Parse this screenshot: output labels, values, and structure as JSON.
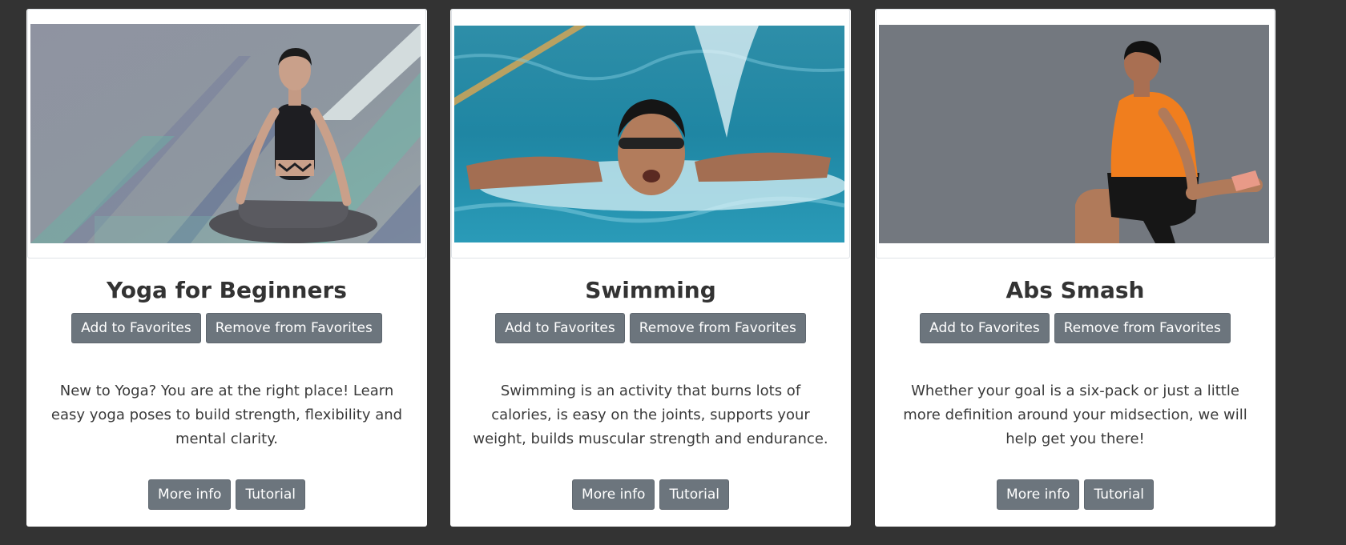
{
  "cards": [
    {
      "title": "Yoga for Beginners",
      "image_subject": "woman meditating in lotus pose",
      "add_label": "Add to Favorites",
      "remove_label": "Remove from Favorites",
      "description": "New to Yoga? You are at the right place! Learn easy yoga poses to build strength, flexibility and mental clarity.",
      "more_info_label": "More info",
      "tutorial_label": "Tutorial"
    },
    {
      "title": "Swimming",
      "image_subject": "swimmer doing butterfly stroke",
      "add_label": "Add to Favorites",
      "remove_label": "Remove from Favorites",
      "description": "Swimming is an activity that burns lots of calories, is easy on the joints, supports your weight, builds muscular strength and endurance.",
      "more_info_label": "More info",
      "tutorial_label": "Tutorial"
    },
    {
      "title": "Abs Smash",
      "image_subject": "man doing a lunge quad stretch",
      "add_label": "Add to Favorites",
      "remove_label": "Remove from Favorites",
      "description": "Whether your goal is a six-pack or just a little more definition around your midsection, we will help get you there!",
      "more_info_label": "More info",
      "tutorial_label": "Tutorial"
    }
  ],
  "colors": {
    "page_background": "#333333",
    "card_background": "#ffffff",
    "button_background": "#6c757d",
    "button_text": "#ffffff",
    "title_text": "#333333"
  }
}
